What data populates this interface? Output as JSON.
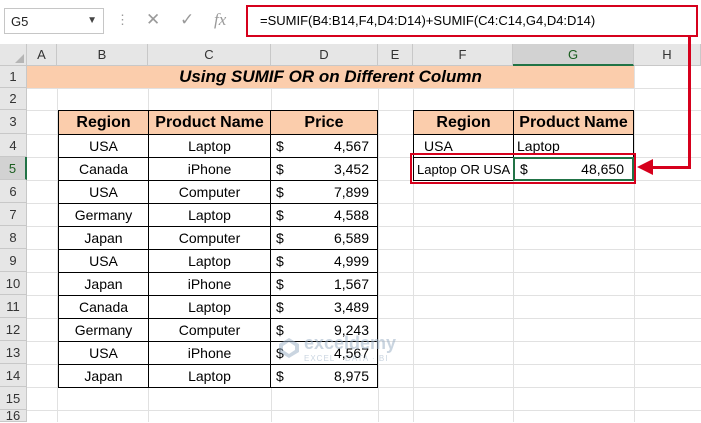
{
  "name_box": "G5",
  "formula_bar": {
    "cancel_glyph": "✕",
    "enter_glyph": "✓",
    "fx_glyph": "fx",
    "formula": "=SUMIF(B4:B14,F4,D4:D14)+SUMIF(C4:C14,G4,D4:D14)"
  },
  "columns": [
    "A",
    "B",
    "C",
    "D",
    "E",
    "F",
    "G",
    "H"
  ],
  "selected_column": "G",
  "rows": [
    "1",
    "2",
    "3",
    "4",
    "5",
    "6",
    "7",
    "8",
    "9",
    "10",
    "11",
    "12",
    "13",
    "14",
    "15",
    "16"
  ],
  "selected_row": "5",
  "title": "Using SUMIF OR on Different Column",
  "main_table": {
    "headers": [
      "Region",
      "Product Name",
      "Price"
    ],
    "currency": "$",
    "rows": [
      [
        "USA",
        "Laptop",
        "4,567"
      ],
      [
        "Canada",
        "iPhone",
        "3,452"
      ],
      [
        "USA",
        "Computer",
        "7,899"
      ],
      [
        "Germany",
        "Laptop",
        "4,588"
      ],
      [
        "Japan",
        "Computer",
        "6,589"
      ],
      [
        "USA",
        "Laptop",
        "4,999"
      ],
      [
        "Japan",
        "iPhone",
        "1,567"
      ],
      [
        "Canada",
        "Laptop",
        "3,489"
      ],
      [
        "Germany",
        "Computer",
        "9,243"
      ],
      [
        "USA",
        "iPhone",
        "4,567"
      ],
      [
        "Japan",
        "Laptop",
        "8,975"
      ]
    ]
  },
  "criteria_table": {
    "headers": [
      "Region",
      "Product Name"
    ],
    "criteria": [
      "USA",
      "Laptop"
    ],
    "result_label": "Laptop OR USA",
    "result_currency": "$",
    "result_value": "48,650"
  },
  "watermark": {
    "name": "exceldemy",
    "tagline": "EXCEL · DATA · BI"
  },
  "colors": {
    "header_fill": "#fbcdac",
    "highlight_red": "#d6001c",
    "excel_green": "#217346"
  }
}
